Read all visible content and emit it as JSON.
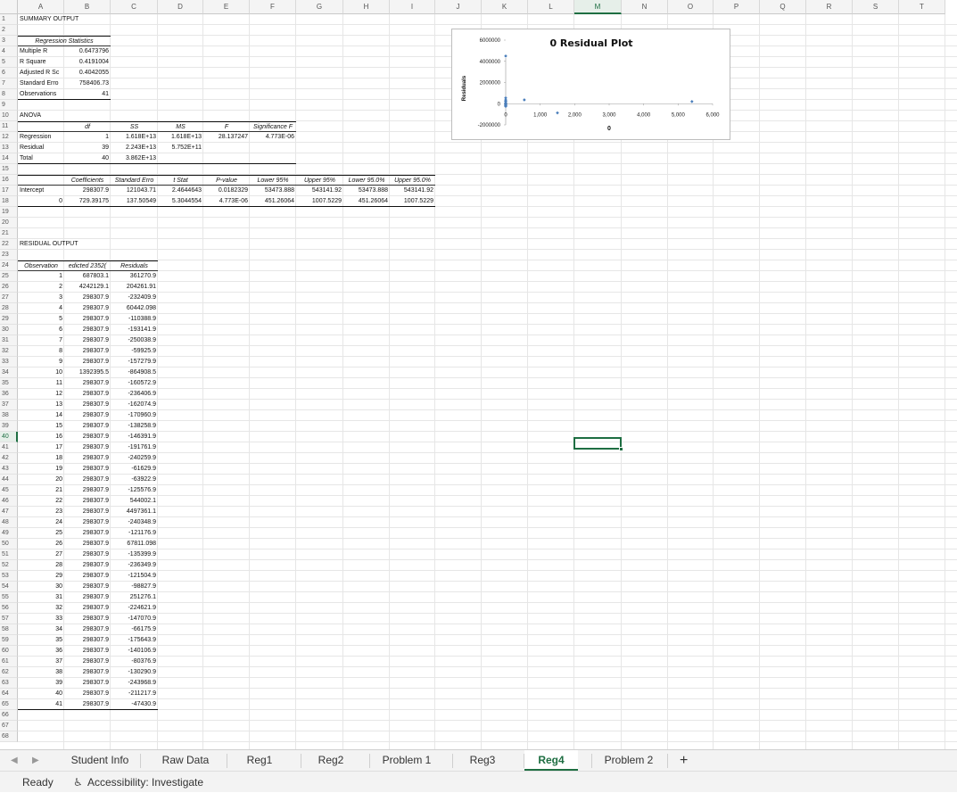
{
  "columns": [
    "A",
    "B",
    "C",
    "D",
    "E",
    "F",
    "G",
    "H",
    "I",
    "J",
    "K",
    "L",
    "M",
    "N",
    "O",
    "P",
    "Q",
    "R",
    "S",
    "T"
  ],
  "selected_column": "M",
  "selected_row": 40,
  "summary_title": "SUMMARY OUTPUT",
  "regression_statistics": {
    "header": "Regression Statistics",
    "rows": [
      {
        "label": "Multiple R",
        "value": "0.6473796"
      },
      {
        "label": "R Square",
        "value": "0.4191004"
      },
      {
        "label": "Adjusted R Sc",
        "value": "0.4042055"
      },
      {
        "label": "Standard Erro",
        "value": "758406.73"
      },
      {
        "label": "Observations",
        "value": "41"
      }
    ]
  },
  "anova": {
    "title": "ANOVA",
    "headers": [
      "",
      "df",
      "SS",
      "MS",
      "F",
      "Significance F"
    ],
    "rows": [
      [
        "Regression",
        "1",
        "1.618E+13",
        "1.618E+13",
        "28.137247",
        "4.773E-06"
      ],
      [
        "Residual",
        "39",
        "2.243E+13",
        "5.752E+11",
        "",
        ""
      ],
      [
        "Total",
        "40",
        "3.862E+13",
        "",
        "",
        ""
      ]
    ]
  },
  "coefficients": {
    "headers": [
      "",
      "Coefficients",
      "Standard Erro",
      "t Stat",
      "P-value",
      "Lower 95%",
      "Upper 95%",
      "Lower 95.0%",
      "Upper 95.0%"
    ],
    "rows": [
      [
        "Intercept",
        "298307.9",
        "121043.71",
        "2.4644643",
        "0.0182329",
        "53473.888",
        "543141.92",
        "53473.888",
        "543141.92"
      ],
      [
        "0",
        "729.39175",
        "137.50549",
        "5.3044554",
        "4.773E-06",
        "451.26064",
        "1007.5229",
        "451.26064",
        "1007.5229"
      ]
    ]
  },
  "residual_output": {
    "title": "RESIDUAL OUTPUT",
    "headers": [
      "Observation",
      "edicted 2352(",
      "Residuals"
    ],
    "rows": [
      [
        "1",
        "687803.1",
        "361270.9"
      ],
      [
        "2",
        "4242129.1",
        "204261.91"
      ],
      [
        "3",
        "298307.9",
        "-232409.9"
      ],
      [
        "4",
        "298307.9",
        "60442.098"
      ],
      [
        "5",
        "298307.9",
        "-110388.9"
      ],
      [
        "6",
        "298307.9",
        "-193141.9"
      ],
      [
        "7",
        "298307.9",
        "-250038.9"
      ],
      [
        "8",
        "298307.9",
        "-59925.9"
      ],
      [
        "9",
        "298307.9",
        "-157279.9"
      ],
      [
        "10",
        "1392395.5",
        "-864908.5"
      ],
      [
        "11",
        "298307.9",
        "-160572.9"
      ],
      [
        "12",
        "298307.9",
        "-236406.9"
      ],
      [
        "13",
        "298307.9",
        "-162074.9"
      ],
      [
        "14",
        "298307.9",
        "-170960.9"
      ],
      [
        "15",
        "298307.9",
        "-138258.9"
      ],
      [
        "16",
        "298307.9",
        "-146391.9"
      ],
      [
        "17",
        "298307.9",
        "-191761.9"
      ],
      [
        "18",
        "298307.9",
        "-240259.9"
      ],
      [
        "19",
        "298307.9",
        "-61629.9"
      ],
      [
        "20",
        "298307.9",
        "-63922.9"
      ],
      [
        "21",
        "298307.9",
        "-125576.9"
      ],
      [
        "22",
        "298307.9",
        "544002.1"
      ],
      [
        "23",
        "298307.9",
        "4497361.1"
      ],
      [
        "24",
        "298307.9",
        "-240348.9"
      ],
      [
        "25",
        "298307.9",
        "-121176.9"
      ],
      [
        "26",
        "298307.9",
        "67811.098"
      ],
      [
        "27",
        "298307.9",
        "-135399.9"
      ],
      [
        "28",
        "298307.9",
        "-236349.9"
      ],
      [
        "29",
        "298307.9",
        "-121504.9"
      ],
      [
        "30",
        "298307.9",
        "-98827.9"
      ],
      [
        "31",
        "298307.9",
        "251276.1"
      ],
      [
        "32",
        "298307.9",
        "-224621.9"
      ],
      [
        "33",
        "298307.9",
        "-147070.9"
      ],
      [
        "34",
        "298307.9",
        "-66175.9"
      ],
      [
        "35",
        "298307.9",
        "-175643.9"
      ],
      [
        "36",
        "298307.9",
        "-140106.9"
      ],
      [
        "37",
        "298307.9",
        "-80376.9"
      ],
      [
        "38",
        "298307.9",
        "-130290.9"
      ],
      [
        "39",
        "298307.9",
        "-243968.9"
      ],
      [
        "40",
        "298307.9",
        "-211217.9"
      ],
      [
        "41",
        "298307.9",
        "-47430.9"
      ]
    ]
  },
  "chart_data": {
    "type": "scatter",
    "title": "0 Residual Plot",
    "xlabel": "0",
    "ylabel": "Residuals",
    "xlim": [
      0,
      6000
    ],
    "ylim": [
      -2000000,
      6000000
    ],
    "x_ticks": [
      "0",
      "1,000",
      "2,000",
      "3,000",
      "4,000",
      "5,000",
      "6,000"
    ],
    "y_ticks": [
      "6000000",
      "4000000",
      "2000000",
      "0",
      "-2000000"
    ],
    "points": [
      [
        0,
        4497361
      ],
      [
        0,
        544002
      ],
      [
        0,
        361271
      ],
      [
        0,
        251276
      ],
      [
        0,
        204262
      ],
      [
        0,
        67811
      ],
      [
        0,
        60442
      ],
      [
        0,
        -47431
      ],
      [
        0,
        -59926
      ],
      [
        0,
        -110389
      ],
      [
        0,
        -157280
      ],
      [
        0,
        -193142
      ],
      [
        0,
        -232410
      ],
      [
        0,
        -250039
      ],
      [
        540,
        361270
      ],
      [
        1500,
        -864909
      ],
      [
        5400,
        204262
      ]
    ],
    "grid": false,
    "color": "#4a7ebb"
  },
  "tabs": [
    "Student Info",
    "Raw Data",
    "Reg1",
    "Reg2",
    "Problem 1",
    "Reg3",
    "Reg4",
    "Problem 2"
  ],
  "active_tab": "Reg4",
  "status": {
    "ready": "Ready",
    "accessibility": "Accessibility: Investigate"
  }
}
